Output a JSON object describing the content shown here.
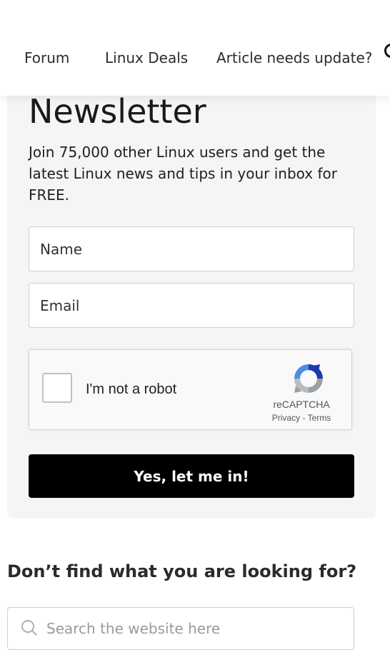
{
  "nav": {
    "items": [
      "Forum",
      "Linux Deals",
      "Article needs update?"
    ],
    "search_icon": "search-icon"
  },
  "newsletter": {
    "title": "Newsletter",
    "description": "Join 75,000 other Linux users and get the latest Linux news and tips in your inbox for FREE.",
    "name_placeholder": "Name",
    "email_placeholder": "Email",
    "submit_label": "Yes, let me in!"
  },
  "recaptcha": {
    "label": "I'm not a robot",
    "brand": "reCAPTCHA",
    "privacy": "Privacy",
    "separator": "-",
    "terms": "Terms"
  },
  "search": {
    "heading": "Don’t find what you are looking for?",
    "placeholder": "Search the website here"
  },
  "colors": {
    "button_bg": "#000000",
    "card_bg": "#f5f5f5"
  }
}
